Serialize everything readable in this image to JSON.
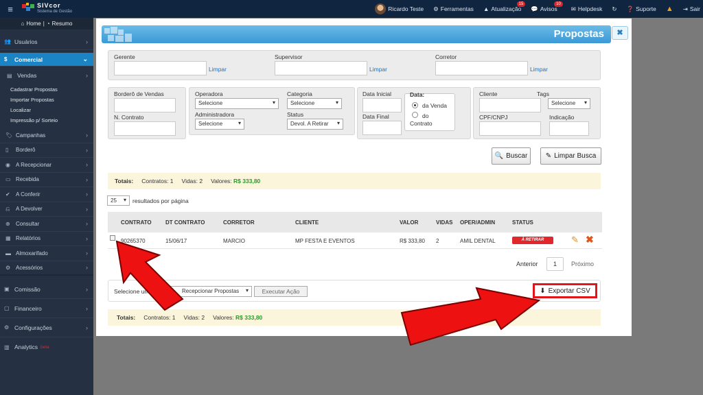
{
  "topbar": {
    "app_name": "SIVcor",
    "app_subtitle": "Sistema de Gestão",
    "user": "Ricardo Teste",
    "ferramentas": "Ferramentas",
    "atualizacao": "Atualização",
    "atualizacao_count": "15",
    "avisos": "Avisos",
    "avisos_count": "10",
    "helpdesk": "Helpdesk",
    "suporte": "Suporte",
    "sair": "Sair"
  },
  "sidebar": {
    "home": "Home",
    "resumo": "Resumo",
    "items": [
      {
        "label": "Usuários",
        "icon": "users-icon"
      },
      {
        "label": "Comercial",
        "icon": "dollar-icon"
      },
      {
        "label": "Vendas",
        "icon": "box-icon"
      },
      {
        "label": "Campanhas",
        "icon": "tag-icon"
      },
      {
        "label": "Borderô",
        "icon": "book-icon"
      },
      {
        "label": "A Recepcionar",
        "icon": "eye-icon"
      },
      {
        "label": "Recebida",
        "icon": "bookmark-icon"
      },
      {
        "label": "A Conferir",
        "icon": "check-circle-icon"
      },
      {
        "label": "A Devolver",
        "icon": "undo-icon"
      },
      {
        "label": "Consultar",
        "icon": "binoculars-icon"
      },
      {
        "label": "Relatórios",
        "icon": "report-icon"
      },
      {
        "label": "Almoxarifado",
        "icon": "archive-icon"
      },
      {
        "label": "Acessórios",
        "icon": "cogs-icon"
      },
      {
        "label": "Comissão",
        "icon": "money-icon"
      },
      {
        "label": "Financeiro",
        "icon": "wallet-icon"
      },
      {
        "label": "Configurações",
        "icon": "gear-icon"
      },
      {
        "label": "Analytics",
        "icon": "chart-icon"
      }
    ],
    "analytics_beta": "beta",
    "vendas_sub": [
      "Cadastrar Propostas",
      "Importar Propostas",
      "Localizar",
      "Impressão p/ Sorteio"
    ]
  },
  "modal": {
    "title": "Propostas",
    "close": "✖",
    "filters": {
      "gerente": "Gerente",
      "supervisor": "Supervisor",
      "corretor": "Corretor",
      "limpar": "Limpar",
      "bordero": "Borderô de Vendas",
      "n_contrato": "N. Contrato",
      "operadora": "Operadora",
      "operadora_value": "Selecione",
      "administradora": "Administradora",
      "administradora_value": "Selecione",
      "categoria": "Categoria",
      "categoria_value": "Selecione",
      "status": "Status",
      "status_value": "Devol. A Retirar",
      "data_inicial": "Data Inicial",
      "data_final": "Data Final",
      "data": "Data:",
      "da_venda": "da Venda",
      "do": "do",
      "contrato": "Contrato",
      "cliente": "Cliente",
      "tags": "Tags",
      "tags_value": "Selecione",
      "cpf_cnpj": "CPF/CNPJ",
      "indicacao": "Indicação"
    },
    "buscar": "Buscar",
    "limpar_busca": "Limpar Busca",
    "totals": {
      "label": "Totais:",
      "contratos": "Contratos: 1",
      "vidas": "Vidas: 2",
      "valores_label": "Valores:",
      "valores": "R$ 333,80"
    },
    "per_page": "25",
    "per_page_label": "resultados por página",
    "table": {
      "headers": [
        "CONTRATO",
        "DT CONTRATO",
        "CORRETOR",
        "CLIENTE",
        "VALOR",
        "VIDAS",
        "OPER/ADMIN",
        "STATUS"
      ],
      "rows": [
        {
          "contrato": "90265370",
          "dt": "15/06/17",
          "corretor": "MARCIO",
          "cliente": "MP FESTA E EVENTOS",
          "valor": "R$ 333,80",
          "vidas": "2",
          "oper": "AMIL DENTAL",
          "status": "À RETIRAR"
        }
      ]
    },
    "pager": {
      "prev": "Anterior",
      "page": "1",
      "next": "Próximo"
    },
    "action_select_prefix": "Selecione um",
    "action_select_value": "Recepcionar Propostas",
    "executar": "Executar Ação",
    "exportar": "Exportar CSV"
  },
  "colors": {
    "accent": "#1a84c5",
    "highlight": "#e0161b",
    "status": "#e1262c"
  }
}
